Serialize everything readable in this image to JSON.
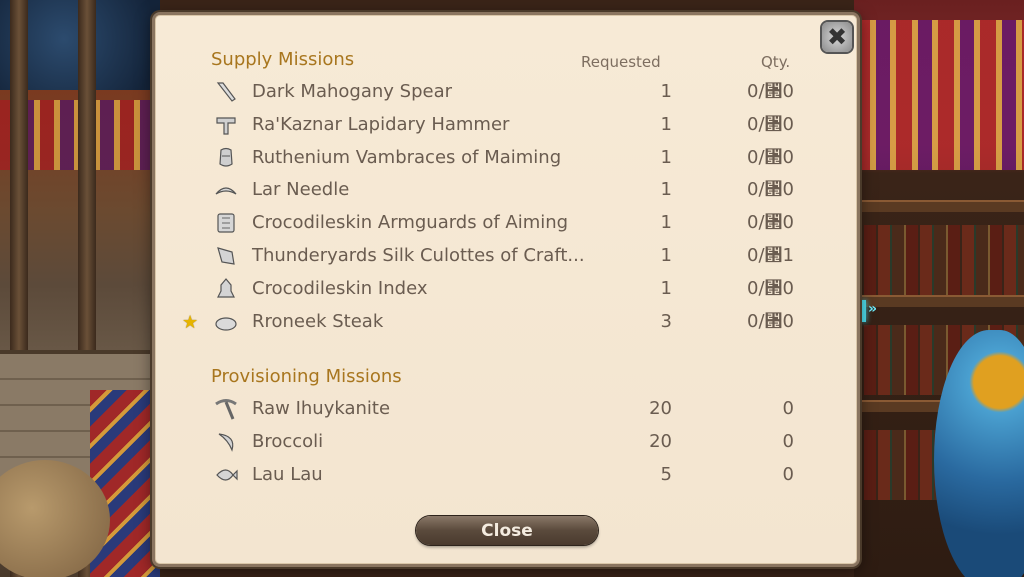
{
  "supply": {
    "title": "Supply Missions",
    "col_requested": "Requested",
    "col_qty": "Qty.",
    "items": [
      {
        "name": "Dark Mahogany Spear",
        "requested": "1",
        "qty": "0/⑒0",
        "icon": "spear-icon",
        "starred": false
      },
      {
        "name": "Ra'Kaznar Lapidary Hammer",
        "requested": "1",
        "qty": "0/⑒0",
        "icon": "hammer-icon",
        "starred": false
      },
      {
        "name": "Ruthenium Vambraces of Maiming",
        "requested": "1",
        "qty": "0/⑒0",
        "icon": "vambraces-icon",
        "starred": false
      },
      {
        "name": "Lar Needle",
        "requested": "1",
        "qty": "0/⑒0",
        "icon": "needle-icon",
        "starred": false
      },
      {
        "name": "Crocodileskin Armguards of Aiming",
        "requested": "1",
        "qty": "0/⑒0",
        "icon": "armguards-icon",
        "starred": false
      },
      {
        "name": "Thunderyards Silk Culottes of Craft...",
        "requested": "1",
        "qty": "0/⑒1",
        "icon": "culottes-icon",
        "starred": false
      },
      {
        "name": "Crocodileskin Index",
        "requested": "1",
        "qty": "0/⑒0",
        "icon": "index-icon",
        "starred": false
      },
      {
        "name": "Rroneek Steak",
        "requested": "3",
        "qty": "0/⑒0",
        "icon": "steak-icon",
        "starred": true
      }
    ]
  },
  "provisioning": {
    "title": "Provisioning Missions",
    "items": [
      {
        "name": "Raw Ihuykanite",
        "requested": "20",
        "qty": "0",
        "icon": "pickaxe-icon"
      },
      {
        "name": "Broccoli",
        "requested": "20",
        "qty": "0",
        "icon": "sickle-icon"
      },
      {
        "name": "Lau Lau",
        "requested": "5",
        "qty": "0",
        "icon": "fish-icon"
      }
    ]
  },
  "close_button": "Close",
  "colors": {
    "heading": "#a8761e",
    "text": "#6a5c50",
    "panel": "#f5e8d4",
    "star": "#e6b400"
  }
}
